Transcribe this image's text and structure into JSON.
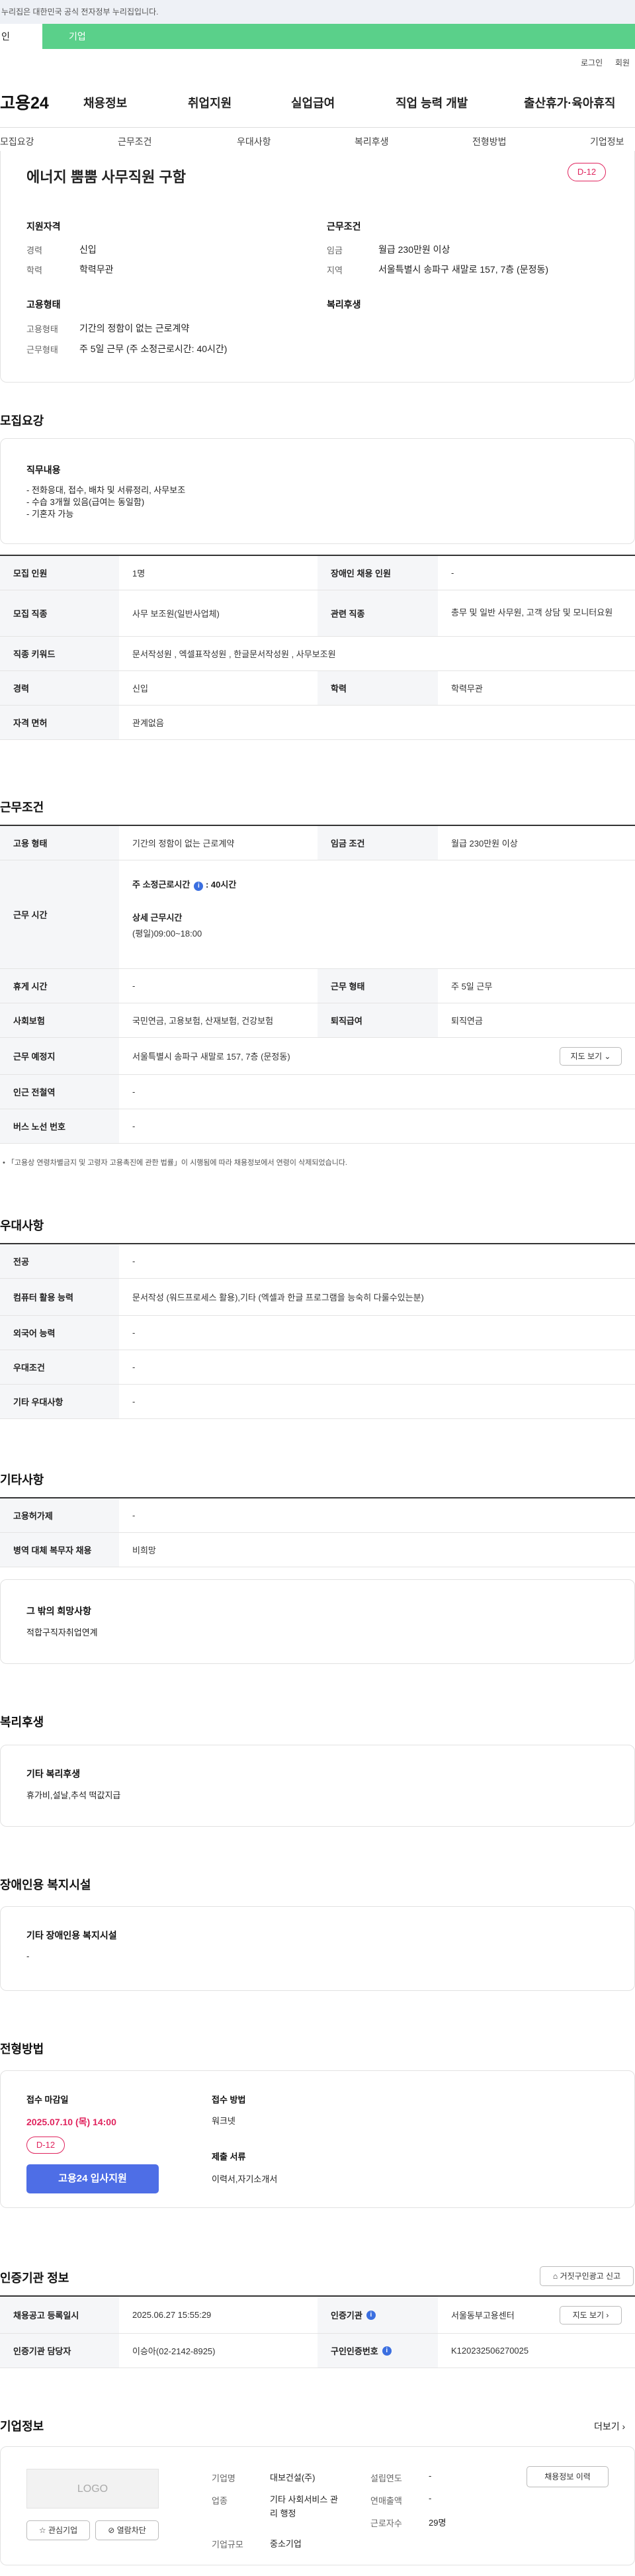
{
  "topbar": {
    "notice": "누리집은 대한민국 공식 전자정부 누리집입니다.",
    "tab_person": "인",
    "tab_company": "기업"
  },
  "util": {
    "login": "로그인",
    "join": "회원"
  },
  "header": {
    "logo": "고용24",
    "nav": [
      "채용정보",
      "취업지원",
      "실업급여",
      "직업 능력 개발",
      "출산휴가·육아휴직"
    ]
  },
  "subnav": [
    "모집요강",
    "근무조건",
    "우대사항",
    "복리후생",
    "전형방법",
    "기업정보"
  ],
  "job": {
    "title": "에너지 뿜뿜 사무직원 구함",
    "dday": "D-12",
    "qual_title": "지원자격",
    "career_label": "경력",
    "career_value": "신입",
    "edu_label": "학력",
    "edu_value": "학력무관",
    "emp_title": "고용형태",
    "emptype_label": "고용형태",
    "emptype_value": "기간의 정함이 없는 근로계약",
    "worktype_label": "근무형태",
    "worktype_value": "주 5일 근무 (주 소정근로시간: 40시간)",
    "cond_title": "근무조건",
    "wage_label": "임금",
    "wage_value": "월급 230만원 이상",
    "region_label": "지역",
    "region_value": "서울특별시 송파구 새말로 157, 7층 (문정동)",
    "welfare_title": "복리후생"
  },
  "recruit": {
    "title": "모집요강",
    "duty_title": "직무내용",
    "duty_lines": [
      "- 전화응대, 접수, 배차 및 서류정리, 사무보조",
      "- 수습 3개월 있음(급여는 동일함)",
      "- 기혼자 가능"
    ],
    "rows": {
      "headcount_label": "모집 인원",
      "headcount_value": "1명",
      "disabled_label": "장애인 채용 인원",
      "disabled_value": "-",
      "job_label": "모집 직종",
      "job_value": "사무 보조원(일반사업체)",
      "related_label": "관련 직종",
      "related_value": "총무 및 일반 사무원, 고객 상담 및 모니터요원",
      "keyword_label": "직종 키워드",
      "keyword_value": "문서작성원 , 엑셀표작성원 , 한글문서작성원 , 사무보조원",
      "career_label": "경력",
      "career_value": "신입",
      "edu_label": "학력",
      "edu_value": "학력무관",
      "license_label": "자격 면허",
      "license_value": "관계없음"
    }
  },
  "workcond": {
    "title": "근무조건",
    "emptype_label": "고용 형태",
    "emptype_value": "기간의 정함이 없는 근로계약",
    "wage_label": "임금 조건",
    "wage_value": "월급 230만원 이상",
    "hours_label": "근무 시간",
    "hours_weekly": "주 소정근로시간",
    "hours_weekly_value": ": 40시간",
    "hours_detail_title": "상세 근무시간",
    "hours_detail_value": "(평일)09:00~18:00",
    "rest_label": "휴게 시간",
    "rest_value": "-",
    "worktype_label": "근무 형태",
    "worktype_value": "주 5일 근무",
    "insurance_label": "사회보험",
    "insurance_value": "국민연금, 고용보험, 산재보험, 건강보험",
    "severance_label": "퇴직급여",
    "severance_value": "퇴직연금",
    "place_label": "근무 예정지",
    "place_value": "서울특별시 송파구 새말로 157, 7층 (문정동)",
    "map_btn": "지도 보기",
    "subway_label": "인근 전철역",
    "subway_value": "-",
    "bus_label": "버스 노선 번호",
    "bus_value": "-",
    "note": "「고용상 연령차별금지 및 고령자 고용촉진에 관한 법률」이 시행됨에 따라 채용정보에서 연령이 삭제되었습니다."
  },
  "pref": {
    "title": "우대사항",
    "major_label": "전공",
    "major_value": "-",
    "computer_label": "컴퓨터 활용 능력",
    "computer_value": "문서작성 (워드프로세스 활용),기타 (엑셀과 한글 프로그램을 능숙히 다룰수있는분)",
    "lang_label": "외국어 능력",
    "lang_value": "-",
    "cond_label": "우대조건",
    "cond_value": "-",
    "etc_label": "기타 우대사항",
    "etc_value": "-"
  },
  "etc": {
    "title": "기타사항",
    "hire_label": "고용허가제",
    "hire_value": "-",
    "military_label": "병역 대체 복무자 채용",
    "military_value": "비희망",
    "wish_title": "그 밖의 희망사항",
    "wish_value": "적합구직자취업연계"
  },
  "welfare": {
    "title": "복리후생",
    "box_title": "기타 복리후생",
    "box_value": "휴가비,설날,추석 떡값지급"
  },
  "disability": {
    "title": "장애인용 복지시설",
    "box_title": "기타 장애인용 복지시설",
    "box_value": "-"
  },
  "process": {
    "title": "전형방법",
    "deadline_title": "접수 마감일",
    "deadline_value": "2025.07.10 (목) 14:00",
    "dday": "D-12",
    "apply_btn": "고용24 입사지원",
    "method_title": "접수 방법",
    "method_value": "워크넷",
    "docs_title": "제출 서류",
    "docs_value": "이력서,자기소개서"
  },
  "cert": {
    "title": "인증기관 정보",
    "report_btn": "거짓구인광고 신고",
    "regdate_label": "채용공고 등록일시",
    "regdate_value": "2025.06.27 15:55:29",
    "agency_label": "인증기관",
    "agency_value": "서울동부고용센터",
    "map_btn": "지도 보기",
    "manager_label": "인증기관 담당자",
    "manager_value": "이승아(02-2142-8925)",
    "certno_label": "구인인증번호",
    "certno_value": "K120232506270025"
  },
  "company": {
    "title": "기업정보",
    "more": "더보기",
    "logo_text": "LOGO",
    "fav_btn": "관심기업",
    "block_btn": "열람차단",
    "name_label": "기업명",
    "name_value": "대보건설(주)",
    "industry_label": "업종",
    "industry_value": "기타 사회서비스 관리 행정",
    "size_label": "기업규모",
    "size_value": "중소기업",
    "founded_label": "설립연도",
    "founded_value": "-",
    "revenue_label": "연매출액",
    "revenue_value": "-",
    "employees_label": "근로자수",
    "employees_value": "29명",
    "jobs_btn": "채용정보 이력"
  }
}
